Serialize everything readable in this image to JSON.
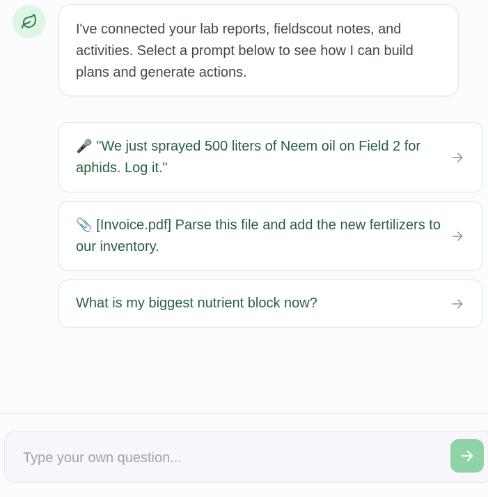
{
  "assistant": {
    "avatar_icon": "leaf-icon",
    "message": "I've connected your lab reports, fieldscout notes, and activities. Select a prompt below to see how I can build plans and generate actions."
  },
  "prompts": [
    {
      "icon": "microphone-emoji",
      "emoji": "🎤",
      "text": "\"We just sprayed 500 liters of Neem oil on Field 2 for aphids. Log it.\""
    },
    {
      "icon": "paperclip-emoji",
      "emoji": "📎",
      "text": "[Invoice.pdf] Parse this file and add the new fertilizers to our inventory."
    },
    {
      "icon": "",
      "emoji": "",
      "text": "What is my biggest nutrient block now?"
    }
  ],
  "input": {
    "placeholder": "Type your own question...",
    "value": ""
  },
  "colors": {
    "avatar_bg": "#ddf7e4",
    "leaf": "#2f7a4b",
    "prompt_text": "#27603d",
    "prompt_border": "#c8eed4",
    "send_button": "#8fd3a6"
  }
}
